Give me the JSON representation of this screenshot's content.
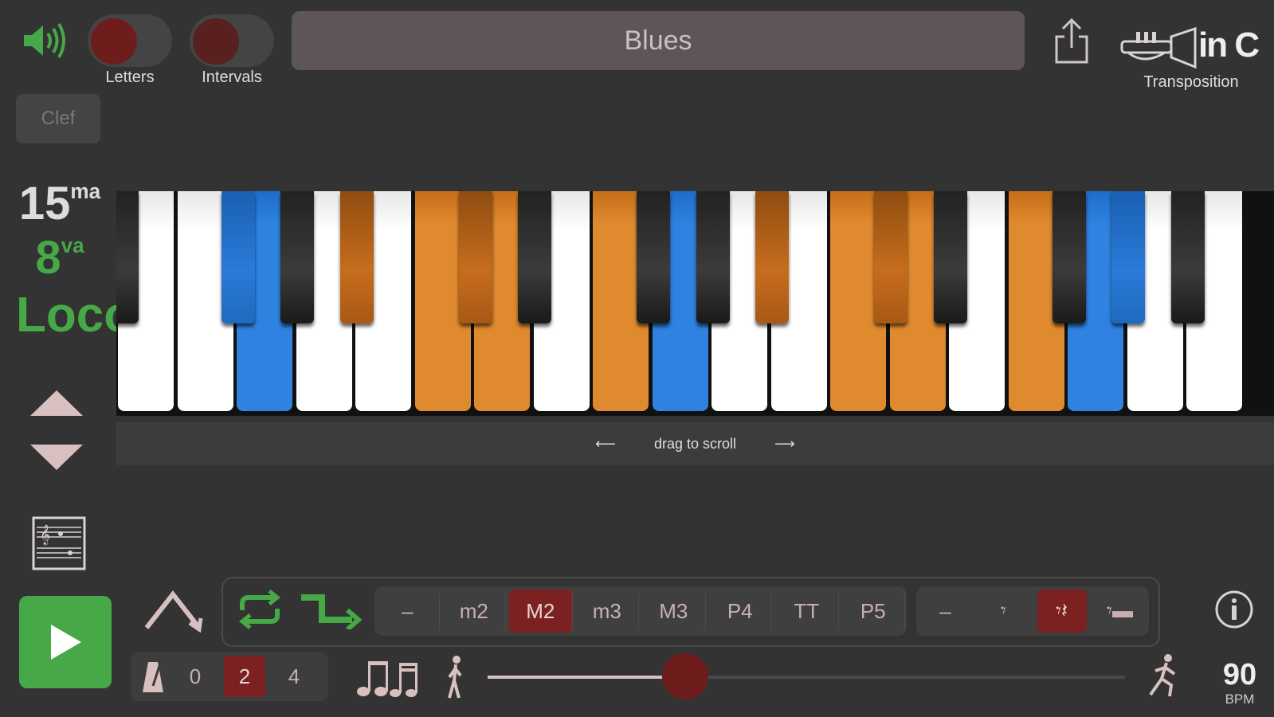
{
  "header": {
    "letters_label": "Letters",
    "intervals_label": "Intervals",
    "scale_name": "Blues",
    "transposition_key": "in C",
    "transposition_label": "Transposition"
  },
  "sidebar": {
    "clef_label": "Clef",
    "octave_15": "15",
    "octave_15_sup": "ma",
    "octave_8": "8",
    "octave_8_sup": "va",
    "loco": "Loco"
  },
  "keyboard": {
    "scroll_hint": "drag to scroll",
    "left_arrow": "⟵",
    "right_arrow": "⟶",
    "colors": {
      "white": "#ffffff",
      "orange": "#e08a30",
      "blue": "#2f82e0",
      "black": "#2a2a2a"
    },
    "white_keys": [
      "white",
      "white",
      "blue",
      "white",
      "white",
      "orange",
      "orange",
      "white",
      "orange",
      "blue",
      "white",
      "white",
      "orange",
      "orange",
      "white",
      "orange",
      "blue",
      "white",
      "white"
    ],
    "black_keys": [
      "black",
      "blue",
      "black",
      "orange",
      "orange",
      "black",
      "black",
      "black",
      "orange",
      "orange",
      "black",
      "black",
      "blue",
      "black",
      "black"
    ]
  },
  "controls": {
    "intervals": [
      "–",
      "m2",
      "M2",
      "m3",
      "M3",
      "P4",
      "TT",
      "P5"
    ],
    "selected_interval": "M2",
    "rests": [
      "–",
      "𝄾",
      "𝄾𝄽",
      "𝄾▬"
    ],
    "selected_rest_index": 2,
    "count_in": [
      "0",
      "2",
      "4"
    ],
    "selected_count_in": "2",
    "tempo": {
      "value": "90",
      "unit": "BPM",
      "level": 0.31
    }
  },
  "accent_colors": {
    "green": "#46a847",
    "maroon": "#7c2121",
    "panel": "#3f3f3f"
  }
}
